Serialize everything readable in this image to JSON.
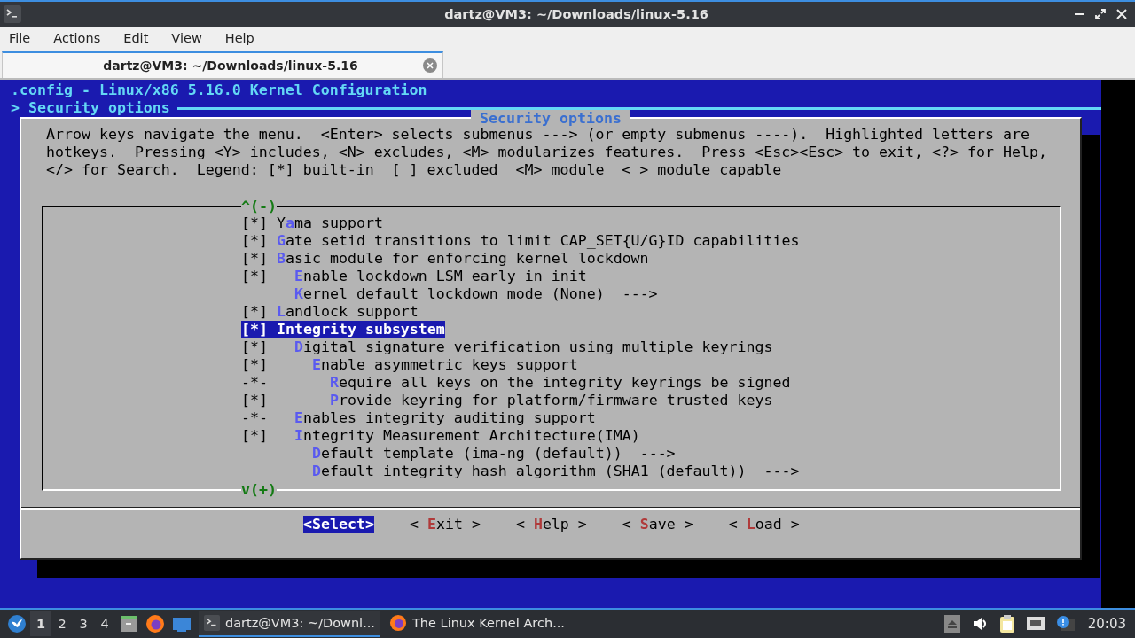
{
  "window": {
    "title": "dartz@VM3: ~/Downloads/linux-5.16"
  },
  "menu_bar": [
    "File",
    "Actions",
    "Edit",
    "View",
    "Help"
  ],
  "tabs": [
    {
      "label": "dartz@VM3: ~/Downloads/linux-5.16",
      "selected": true
    }
  ],
  "terminal": {
    "header": ".config - Linux/x86 5.16.0 Kernel Configuration",
    "breadcrumb": "> Security options",
    "dialog": {
      "title": "Security options",
      "help_lines": [
        "Arrow keys navigate the menu.  <Enter> selects submenus ---> (or empty submenus ----).  Highlighted letters are",
        "hotkeys.  Pressing <Y> includes, <N> excludes, <M> modularizes features.  Press <Esc><Esc> to exit, <?> for Help,",
        "</> for Search.  Legend: [*] built-in  [ ] excluded  <M> module  < > module capable"
      ],
      "scroll_up": "^(-)",
      "scroll_down": "v(+)",
      "items": [
        {
          "state": "[*]",
          "lead": "Y",
          "hotkey": "a",
          "rest": "ma support",
          "selected": false
        },
        {
          "state": "[*]",
          "hotkey": "G",
          "rest": "ate setid transitions to limit CAP_SET{U/G}ID capabilities",
          "selected": false
        },
        {
          "state": "[*]",
          "hotkey": "B",
          "rest": "asic module for enforcing kernel lockdown",
          "selected": false,
          "children": [
            {
              "state": "[*]",
              "hotkey": "E",
              "rest": "nable lockdown LSM early in init",
              "selected": false
            },
            {
              "hotkey": "K",
              "rest": "ernel default lockdown mode (None)  --->",
              "selected": false
            }
          ]
        },
        {
          "state": "[*]",
          "hotkey": "L",
          "rest": "andlock support",
          "selected": false
        },
        {
          "state": "[*]",
          "hotkey": "I",
          "rest": "ntegrity subsystem",
          "selected": true,
          "children": [
            {
              "state": "[*]",
              "hotkey": "D",
              "rest": "igital signature verification using multiple keyrings",
              "selected": false,
              "children": [
                {
                  "state": "[*]",
                  "hotkey": "E",
                  "rest": "nable asymmetric keys support",
                  "selected": false,
                  "children": [
                    {
                      "state": "-*-",
                      "hotkey": "R",
                      "rest": "equire all keys on the integrity keyrings be signed",
                      "selected": false
                    },
                    {
                      "state": "[*]",
                      "hotkey": "P",
                      "rest": "rovide keyring for platform/firmware trusted keys",
                      "selected": false
                    }
                  ]
                }
              ]
            },
            {
              "state": "-*-",
              "hotkey": "E",
              "rest": "nables integrity auditing support",
              "selected": false
            },
            {
              "state": "[*]",
              "hotkey": "I",
              "rest": "ntegrity Measurement Architecture(IMA)",
              "selected": false,
              "children": [
                {
                  "hotkey": "D",
                  "rest": "efault template (ima-ng (default))  --->",
                  "selected": false
                },
                {
                  "hotkey": "D",
                  "rest": "efault integrity hash algorithm (SHA1 (default))  --->",
                  "selected": false
                }
              ]
            }
          ]
        }
      ],
      "buttons": [
        {
          "lead": "<",
          "hotkey": "S",
          "rest": "elect>",
          "selected": true
        },
        {
          "lead": "< ",
          "hotkey": "E",
          "rest": "xit >",
          "selected": false
        },
        {
          "lead": "< ",
          "hotkey": "H",
          "rest": "elp >",
          "selected": false
        },
        {
          "lead": "< ",
          "hotkey": "S",
          "rest": "ave >",
          "selected": false
        },
        {
          "lead": "< ",
          "hotkey": "L",
          "rest": "oad >",
          "selected": false
        }
      ]
    }
  },
  "taskbar": {
    "workspaces": [
      {
        "label": "1",
        "selected": true
      },
      {
        "label": "2",
        "selected": false
      },
      {
        "label": "3",
        "selected": false
      },
      {
        "label": "4",
        "selected": false
      }
    ],
    "tasks": [
      {
        "kind": "terminal",
        "label": "dartz@VM3: ~/Downl...",
        "selected": true
      },
      {
        "kind": "browser",
        "label": "The Linux Kernel Arch...",
        "selected": false
      }
    ],
    "clock": "20:03"
  }
}
